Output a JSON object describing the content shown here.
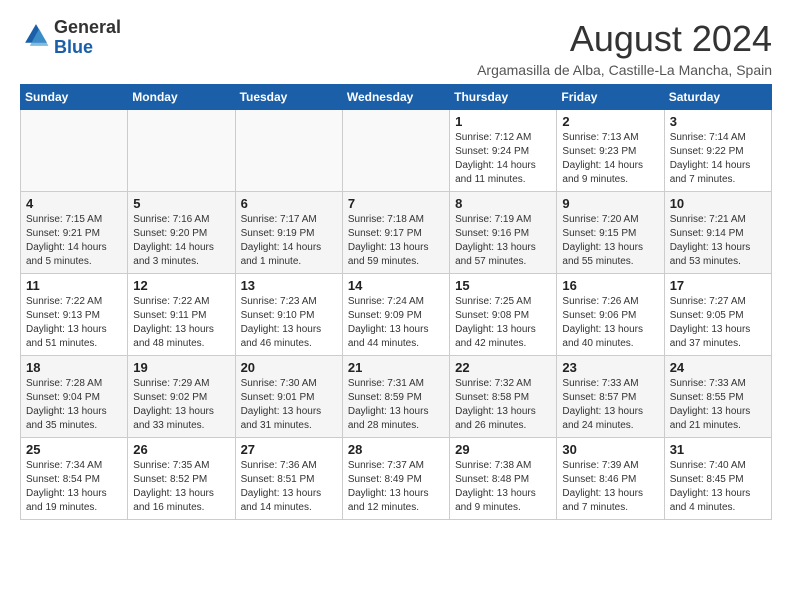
{
  "header": {
    "logo_general": "General",
    "logo_blue": "Blue",
    "month_year": "August 2024",
    "location": "Argamasilla de Alba, Castille-La Mancha, Spain"
  },
  "days_of_week": [
    "Sunday",
    "Monday",
    "Tuesday",
    "Wednesday",
    "Thursday",
    "Friday",
    "Saturday"
  ],
  "weeks": [
    [
      {
        "day": "",
        "info": ""
      },
      {
        "day": "",
        "info": ""
      },
      {
        "day": "",
        "info": ""
      },
      {
        "day": "",
        "info": ""
      },
      {
        "day": "1",
        "info": "Sunrise: 7:12 AM\nSunset: 9:24 PM\nDaylight: 14 hours\nand 11 minutes."
      },
      {
        "day": "2",
        "info": "Sunrise: 7:13 AM\nSunset: 9:23 PM\nDaylight: 14 hours\nand 9 minutes."
      },
      {
        "day": "3",
        "info": "Sunrise: 7:14 AM\nSunset: 9:22 PM\nDaylight: 14 hours\nand 7 minutes."
      }
    ],
    [
      {
        "day": "4",
        "info": "Sunrise: 7:15 AM\nSunset: 9:21 PM\nDaylight: 14 hours\nand 5 minutes."
      },
      {
        "day": "5",
        "info": "Sunrise: 7:16 AM\nSunset: 9:20 PM\nDaylight: 14 hours\nand 3 minutes."
      },
      {
        "day": "6",
        "info": "Sunrise: 7:17 AM\nSunset: 9:19 PM\nDaylight: 14 hours\nand 1 minute."
      },
      {
        "day": "7",
        "info": "Sunrise: 7:18 AM\nSunset: 9:17 PM\nDaylight: 13 hours\nand 59 minutes."
      },
      {
        "day": "8",
        "info": "Sunrise: 7:19 AM\nSunset: 9:16 PM\nDaylight: 13 hours\nand 57 minutes."
      },
      {
        "day": "9",
        "info": "Sunrise: 7:20 AM\nSunset: 9:15 PM\nDaylight: 13 hours\nand 55 minutes."
      },
      {
        "day": "10",
        "info": "Sunrise: 7:21 AM\nSunset: 9:14 PM\nDaylight: 13 hours\nand 53 minutes."
      }
    ],
    [
      {
        "day": "11",
        "info": "Sunrise: 7:22 AM\nSunset: 9:13 PM\nDaylight: 13 hours\nand 51 minutes."
      },
      {
        "day": "12",
        "info": "Sunrise: 7:22 AM\nSunset: 9:11 PM\nDaylight: 13 hours\nand 48 minutes."
      },
      {
        "day": "13",
        "info": "Sunrise: 7:23 AM\nSunset: 9:10 PM\nDaylight: 13 hours\nand 46 minutes."
      },
      {
        "day": "14",
        "info": "Sunrise: 7:24 AM\nSunset: 9:09 PM\nDaylight: 13 hours\nand 44 minutes."
      },
      {
        "day": "15",
        "info": "Sunrise: 7:25 AM\nSunset: 9:08 PM\nDaylight: 13 hours\nand 42 minutes."
      },
      {
        "day": "16",
        "info": "Sunrise: 7:26 AM\nSunset: 9:06 PM\nDaylight: 13 hours\nand 40 minutes."
      },
      {
        "day": "17",
        "info": "Sunrise: 7:27 AM\nSunset: 9:05 PM\nDaylight: 13 hours\nand 37 minutes."
      }
    ],
    [
      {
        "day": "18",
        "info": "Sunrise: 7:28 AM\nSunset: 9:04 PM\nDaylight: 13 hours\nand 35 minutes."
      },
      {
        "day": "19",
        "info": "Sunrise: 7:29 AM\nSunset: 9:02 PM\nDaylight: 13 hours\nand 33 minutes."
      },
      {
        "day": "20",
        "info": "Sunrise: 7:30 AM\nSunset: 9:01 PM\nDaylight: 13 hours\nand 31 minutes."
      },
      {
        "day": "21",
        "info": "Sunrise: 7:31 AM\nSunset: 8:59 PM\nDaylight: 13 hours\nand 28 minutes."
      },
      {
        "day": "22",
        "info": "Sunrise: 7:32 AM\nSunset: 8:58 PM\nDaylight: 13 hours\nand 26 minutes."
      },
      {
        "day": "23",
        "info": "Sunrise: 7:33 AM\nSunset: 8:57 PM\nDaylight: 13 hours\nand 24 minutes."
      },
      {
        "day": "24",
        "info": "Sunrise: 7:33 AM\nSunset: 8:55 PM\nDaylight: 13 hours\nand 21 minutes."
      }
    ],
    [
      {
        "day": "25",
        "info": "Sunrise: 7:34 AM\nSunset: 8:54 PM\nDaylight: 13 hours\nand 19 minutes."
      },
      {
        "day": "26",
        "info": "Sunrise: 7:35 AM\nSunset: 8:52 PM\nDaylight: 13 hours\nand 16 minutes."
      },
      {
        "day": "27",
        "info": "Sunrise: 7:36 AM\nSunset: 8:51 PM\nDaylight: 13 hours\nand 14 minutes."
      },
      {
        "day": "28",
        "info": "Sunrise: 7:37 AM\nSunset: 8:49 PM\nDaylight: 13 hours\nand 12 minutes."
      },
      {
        "day": "29",
        "info": "Sunrise: 7:38 AM\nSunset: 8:48 PM\nDaylight: 13 hours\nand 9 minutes."
      },
      {
        "day": "30",
        "info": "Sunrise: 7:39 AM\nSunset: 8:46 PM\nDaylight: 13 hours\nand 7 minutes."
      },
      {
        "day": "31",
        "info": "Sunrise: 7:40 AM\nSunset: 8:45 PM\nDaylight: 13 hours\nand 4 minutes."
      }
    ]
  ]
}
